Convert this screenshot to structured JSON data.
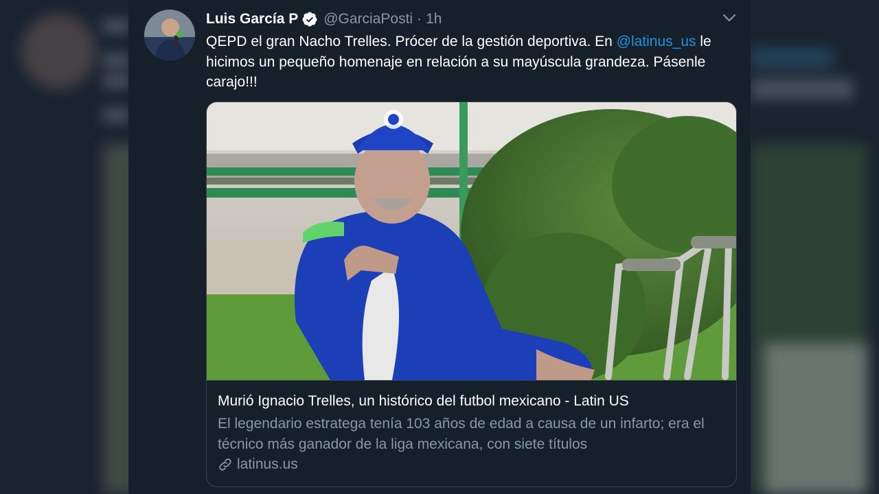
{
  "tweet": {
    "display_name": "Luis García P",
    "handle": "@GarciaPosti",
    "separator": "·",
    "time": "1h",
    "text_before": "QEPD el gran Nacho Trelles. Prócer de la gestión deportiva. En ",
    "mention": "@latinus_us",
    "text_after": " le hicimos un pequeño homenaje en relación a su mayúscula grandeza. Pásenle carajo!!!"
  },
  "card": {
    "title": "Murió Ignacio Trelles, un histórico del futbol mexicano - Latin US",
    "description": "El legendario estratega tenía 103 años de edad a causa de un infarto; era el técnico más ganador de la liga mexicana, con siete títulos",
    "domain": "latinus.us"
  },
  "colors": {
    "background": "#15202b",
    "accent": "#1b95e0",
    "secondary_text": "#8899a6",
    "border": "#38444d"
  },
  "icons": [
    "verified-badge-icon",
    "chevron-down-icon",
    "link-icon"
  ]
}
